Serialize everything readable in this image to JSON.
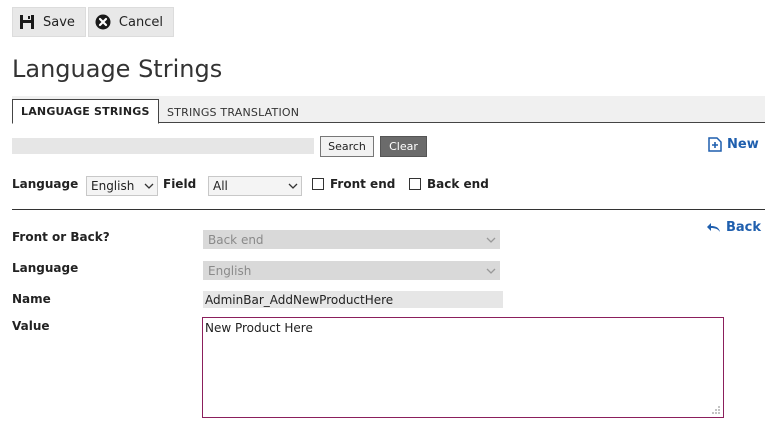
{
  "toolbar": {
    "save_label": "Save",
    "cancel_label": "Cancel"
  },
  "page": {
    "title": "Language Strings"
  },
  "tabs": [
    {
      "label": "LANGUAGE STRINGS",
      "active": true
    },
    {
      "label": "STRINGS TRANSLATION",
      "active": false
    }
  ],
  "search": {
    "value": "",
    "search_label": "Search",
    "clear_label": "Clear",
    "new_label": "New"
  },
  "filters": {
    "language_label": "Language",
    "language_value": "English",
    "field_label": "Field",
    "field_value": "All",
    "front_end_label": "Front end",
    "front_end_checked": false,
    "back_end_label": "Back end",
    "back_end_checked": false
  },
  "form": {
    "back_label": "Back",
    "front_or_back_label": "Front or Back?",
    "front_or_back_value": "Back end",
    "language_label": "Language",
    "language_value": "English",
    "name_label": "Name",
    "name_value": "AdminBar_AddNewProductHere",
    "value_label": "Value",
    "value_text": "New Product Here"
  },
  "colors": {
    "link": "#1f5fae",
    "textarea_border": "#8b1f5c",
    "clear_button": "#6b6b6b"
  }
}
